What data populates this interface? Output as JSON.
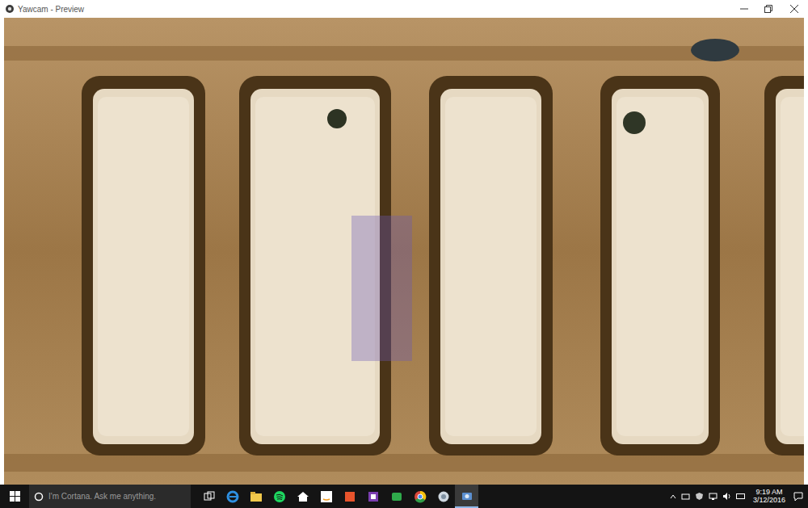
{
  "window": {
    "title": "Yawcam - Preview"
  },
  "taskbar": {
    "search": {
      "placeholder": "I'm Cortana. Ask me anything."
    },
    "clock": {
      "time": "9:19 AM",
      "date": "3/12/2016"
    }
  }
}
